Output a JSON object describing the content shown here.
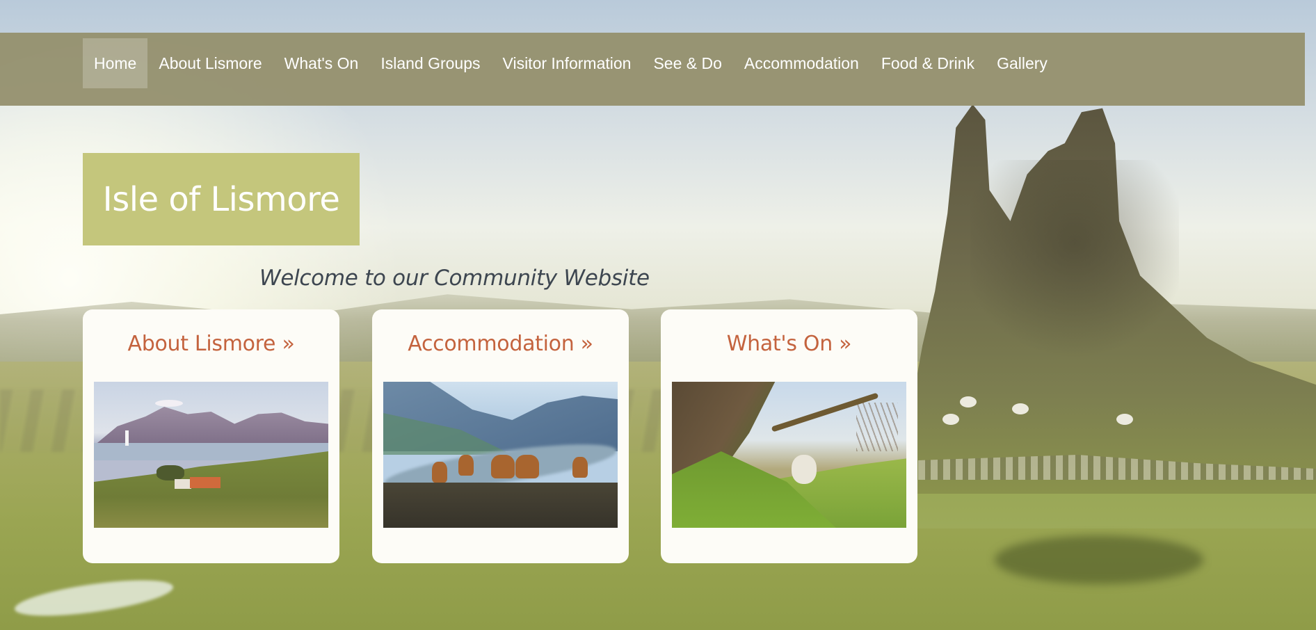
{
  "nav": {
    "items": [
      {
        "label": "Home",
        "active": true
      },
      {
        "label": "About Lismore",
        "active": false
      },
      {
        "label": "What's On",
        "active": false
      },
      {
        "label": "Island Groups",
        "active": false
      },
      {
        "label": "Visitor Information",
        "active": false
      },
      {
        "label": "See & Do",
        "active": false
      },
      {
        "label": "Accommodation",
        "active": false
      },
      {
        "label": "Food & Drink",
        "active": false
      },
      {
        "label": "Gallery",
        "active": false
      }
    ]
  },
  "header": {
    "site_title": "Isle of Lismore",
    "tagline": "Welcome to our Community Website"
  },
  "cards": [
    {
      "title": "About Lismore »"
    },
    {
      "title": "Accommodation »"
    },
    {
      "title": "What's On »"
    }
  ],
  "colors": {
    "nav_background": "#969270",
    "title_box": "#c4c67c",
    "card_title": "#c4633e",
    "card_background": "#fdfcf7"
  }
}
